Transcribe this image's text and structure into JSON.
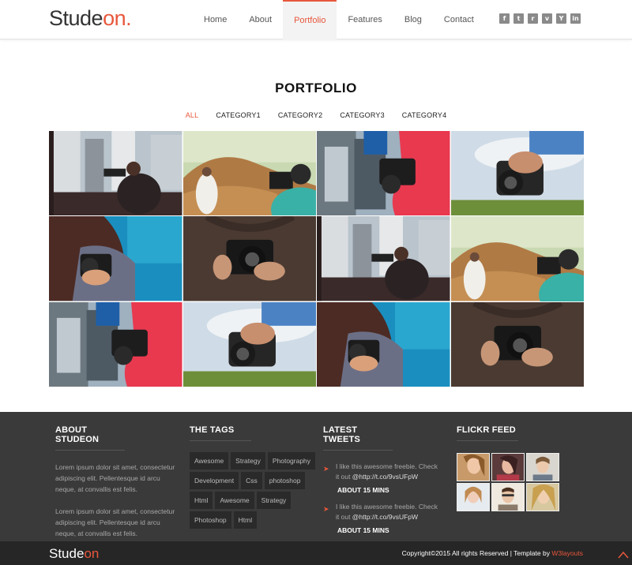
{
  "header": {
    "logo_main": "Stude",
    "logo_accent": "on.",
    "nav": [
      "Home",
      "About",
      "Portfolio",
      "Features",
      "Blog",
      "Contact"
    ],
    "active_nav": "Portfolio",
    "social": [
      {
        "name": "facebook-icon",
        "glyph": "f"
      },
      {
        "name": "twitter-icon",
        "glyph": "t"
      },
      {
        "name": "rss-icon",
        "glyph": "r"
      },
      {
        "name": "vimeo-icon",
        "glyph": "v"
      },
      {
        "name": "youtube-icon",
        "glyph": "Y"
      },
      {
        "name": "linkedin-icon",
        "glyph": "in"
      }
    ]
  },
  "portfolio": {
    "title": "PORTFOLIO",
    "filters": [
      "ALL",
      "CATEGORY1",
      "CATEGORY2",
      "CATEGORY3",
      "CATEGORY4"
    ],
    "active_filter": "ALL",
    "tiles": [
      "city-photographer",
      "wedding-photographer",
      "red-sleeve-camera",
      "camera-sky",
      "woman-camera-blue",
      "camera-strap-brown",
      "city-photographer",
      "wedding-photographer",
      "red-sleeve-camera",
      "camera-sky",
      "woman-camera-blue",
      "camera-strap-brown"
    ]
  },
  "footer": {
    "about": {
      "title": "ABOUT STUDEON",
      "p1": "Lorem ipsum dolor sit amet, consectetur adipiscing elit. Pellentesque id arcu neque, at convallis est felis.",
      "p2": "Lorem ipsum dolor sit amet, consectetur adipiscing elit. Pellentesque id arcu neque, at convallis est felis."
    },
    "tags": {
      "title": "THE TAGS",
      "items": [
        "Awesome",
        "Strategy",
        "Photography",
        "Development",
        "Css",
        "photoshop",
        "Html",
        "Awesome",
        "Strategy",
        "Photoshop",
        "Html"
      ]
    },
    "tweets": {
      "title": "LATEST TWEETS",
      "items": [
        {
          "text": "I like this awesome freebie. Check it out ",
          "link": "@http://t.co/9vsUFpW",
          "time": "ABOUT 15 MINS"
        },
        {
          "text": "I like this awesome freebie. Check it out ",
          "link": "@http://t.co/9vsUFpW",
          "time": "ABOUT 15 MINS"
        }
      ]
    },
    "flickr": {
      "title": "FLICKR FEED"
    }
  },
  "bottom": {
    "logo_main": "Stude",
    "logo_accent": "on",
    "copyright": "Copyright©2015 All rights Reserved | Template by ",
    "credit": "W3layouts"
  },
  "colors": {
    "accent": "#e8573c",
    "footer": "#3a3a3a",
    "bottom": "#262626"
  }
}
